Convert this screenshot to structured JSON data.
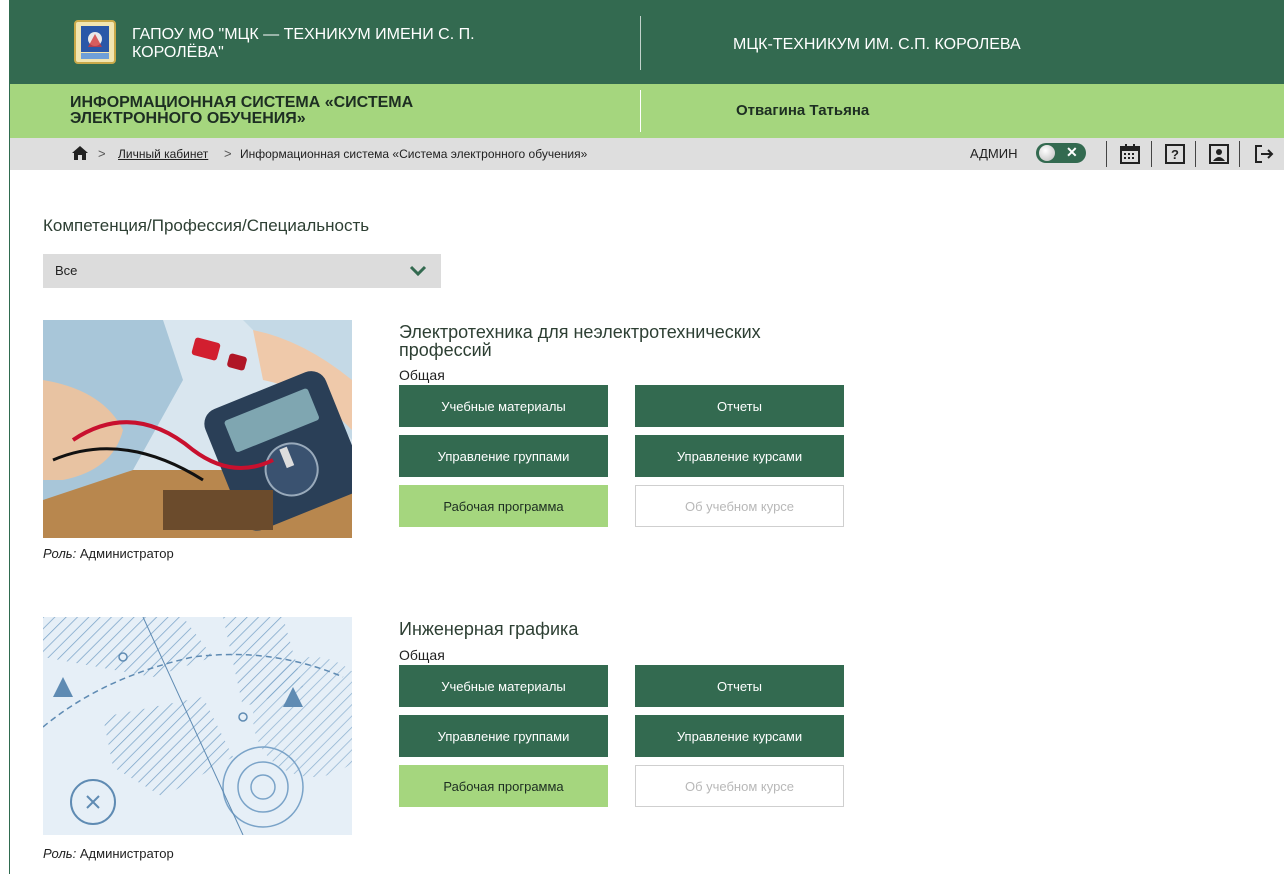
{
  "header": {
    "org_title": "ГАПОУ МО \"МЦК — ТЕХНИКУМ ИМЕНИ С. П. КОРОЛЁВА\"",
    "site_name": "МЦК-ТЕХНИКУМ ИМ. С.П. КОРОЛЕВА",
    "system_title": "ИНФОРМАЦИОННАЯ СИСТЕМА «СИСТЕМА ЭЛЕКТРОННОГО ОБУЧЕНИЯ»",
    "user_name": "Отвагина Татьяна"
  },
  "breadcrumb": {
    "home_icon": "home-icon",
    "separator": ">",
    "link": "Личный кабинет",
    "current": "Информационная система «Система электронного обучения»"
  },
  "toolbar": {
    "admin_label": "АДМИН",
    "toggle_state": "off",
    "icons": [
      "calendar-icon",
      "help-icon",
      "profile-icon",
      "logout-icon"
    ]
  },
  "filter": {
    "label": "Компетенция/Профессия/Специальность",
    "selected": "Все"
  },
  "courses": [
    {
      "title": "Электротехника для неэлектротехнических профессий",
      "type": "Общая",
      "role_label": "Роль:",
      "role_value": "Администратор",
      "buttons": {
        "materials": "Учебные материалы",
        "reports": "Отчеты",
        "groups": "Управление группами",
        "manage": "Управление курсами",
        "program": "Рабочая программа",
        "about": "Об учебном курсе"
      }
    },
    {
      "title": "Инженерная графика",
      "type": "Общая",
      "role_label": "Роль:",
      "role_value": "Администратор",
      "buttons": {
        "materials": "Учебные материалы",
        "reports": "Отчеты",
        "groups": "Управление группами",
        "manage": "Управление курсами",
        "program": "Рабочая программа",
        "about": "Об учебном курсе"
      }
    }
  ],
  "colors": {
    "primary_dark": "#336a50",
    "accent_light": "#a5d67e",
    "breadcrumb_bg": "#dedede"
  }
}
